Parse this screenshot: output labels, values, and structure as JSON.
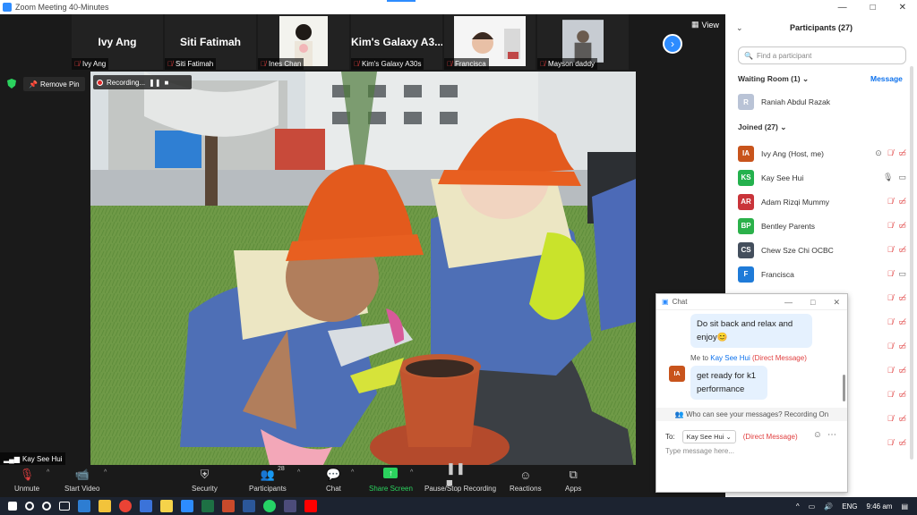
{
  "window": {
    "title": "Zoom Meeting 40-Minutes"
  },
  "strip": {
    "tiles": [
      {
        "big": "Ivy Ang",
        "caption": "Ivy Ang"
      },
      {
        "big": "Siti Fatimah",
        "caption": "Siti Fatimah"
      },
      {
        "big": "",
        "caption": "Ines Chan"
      },
      {
        "big": "Kim's Galaxy A3...",
        "caption": "Kim's Galaxy A30s"
      },
      {
        "big": "",
        "caption": "Francisca"
      },
      {
        "big": "",
        "caption": "Mayson daddy"
      }
    ],
    "view_label": "View"
  },
  "stage": {
    "remove_pin_label": "Remove Pin",
    "recording_label": "Recording...",
    "speaker_tag": "Kay See Hui"
  },
  "toolbar": {
    "unmute": "Unmute",
    "start_video": "Start Video",
    "security": "Security",
    "participants": "Participants",
    "participants_count": "28",
    "chat": "Chat",
    "share_screen": "Share Screen",
    "pause_recording": "Pause/Stop Recording",
    "reactions": "Reactions",
    "apps": "Apps"
  },
  "panel": {
    "title": "Participants (27)",
    "search_placeholder": "Find a participant",
    "waiting_room": "Waiting Room (1)",
    "message_label": "Message",
    "waiting": [
      {
        "initial": "R",
        "name": "Raniah Abdul Razak",
        "color": "#b9c3d6"
      }
    ],
    "joined_head": "Joined (27)",
    "joined": [
      {
        "initial": "IA",
        "name": "Ivy Ang (Host, me)",
        "color": "#c8541c"
      },
      {
        "initial": "KS",
        "name": "Kay See Hui",
        "color": "#24b14d"
      },
      {
        "initial": "AR",
        "name": "Adam Rizqi Mummy",
        "color": "#c9343a"
      },
      {
        "initial": "BP",
        "name": "Bentley Parents",
        "color": "#2bb14a"
      },
      {
        "initial": "CS",
        "name": "Chew Sze Chi OCBC",
        "color": "#444f5d"
      },
      {
        "initial": "F",
        "name": "Francisca",
        "color": "#1f7bd8"
      }
    ]
  },
  "chat": {
    "title": "Chat",
    "msg1": "Do sit back and relax and enjoy",
    "msg1_emoji": "😊",
    "sender_prefix": "Me to",
    "sender_name": "Kay See Hui",
    "sender_dm": "(Direct Message)",
    "avatar": "IA",
    "msg2": "get ready for k1 performance",
    "who_can_see": "Who can see your messages? Recording On",
    "to_label": "To:",
    "to_value": "Kay See Hui",
    "to_dm": "(Direct Message)",
    "input_placeholder": "Type message here..."
  },
  "taskbar": {
    "lang": "ENG",
    "time": "9:46 am"
  }
}
